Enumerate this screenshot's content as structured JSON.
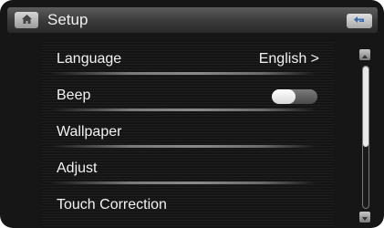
{
  "header": {
    "title": "Setup",
    "home_icon": "home-icon",
    "back_icon": "return-icon"
  },
  "menu": {
    "items": [
      {
        "label": "Language",
        "value": "English >"
      },
      {
        "label": "Beep",
        "toggle_on": true
      },
      {
        "label": "Wallpaper"
      },
      {
        "label": "Adjust"
      },
      {
        "label": "Touch Correction"
      }
    ]
  },
  "scrollbar": {
    "up_icon": "scroll-up-icon",
    "down_icon": "scroll-down-icon",
    "position_fraction": 0.0
  }
}
